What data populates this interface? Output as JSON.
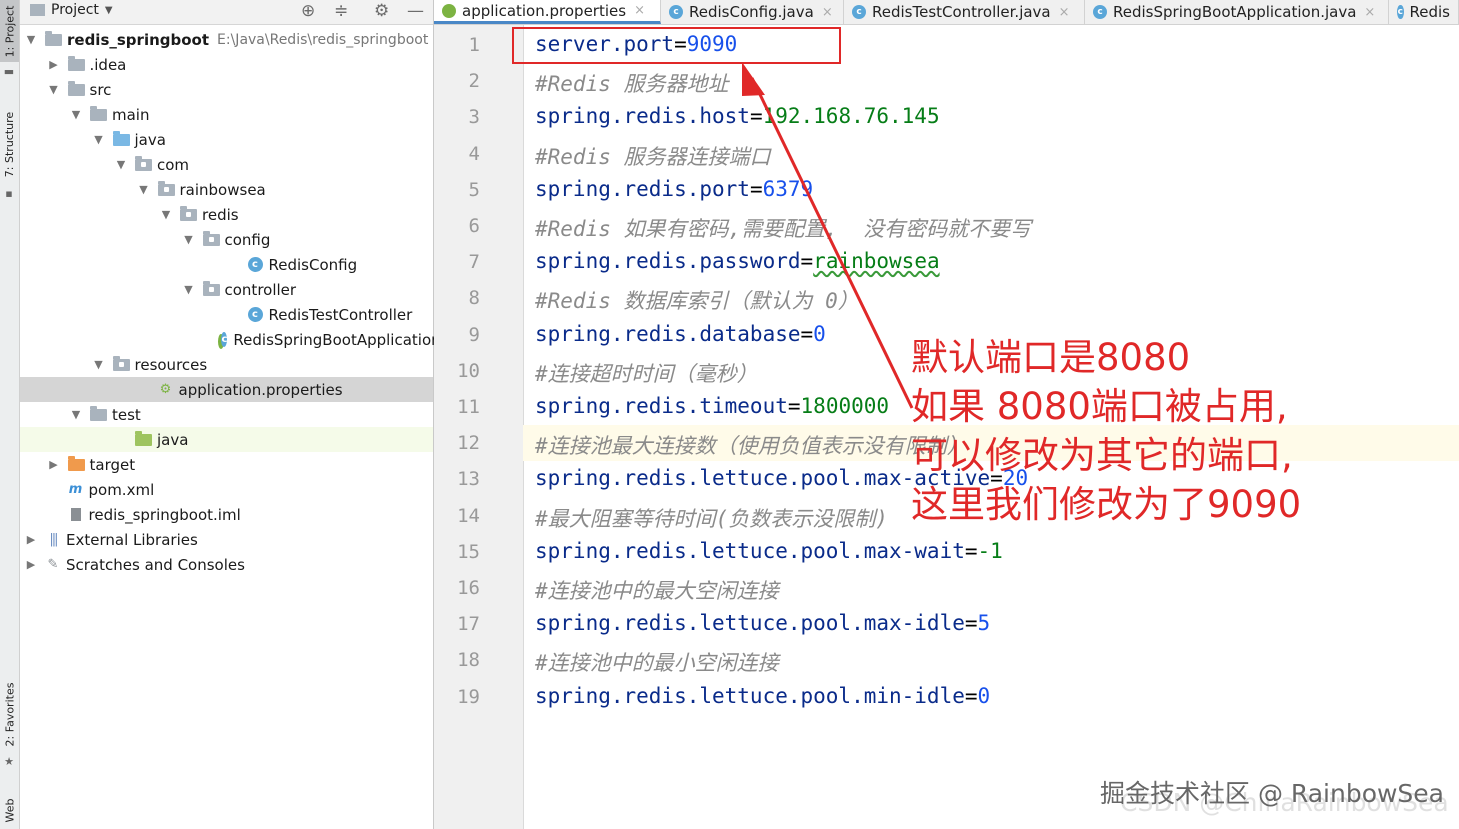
{
  "toolstrip": {
    "project_tab": "1: Project",
    "structure_tab": "7: Structure",
    "favorites_tab": "2: Favorites",
    "web_tab": "Web"
  },
  "project_panel": {
    "title": "Project",
    "tree": [
      {
        "label": "redis_springboot",
        "path": "E:\\Java\\Redis\\redis_springboot",
        "icon": "folder",
        "expanded": true
      },
      {
        "label": ".idea",
        "icon": "folder",
        "expanded": false
      },
      {
        "label": "src",
        "icon": "folder",
        "expanded": true
      },
      {
        "label": "main",
        "icon": "folder",
        "expanded": true
      },
      {
        "label": "java",
        "icon": "source-folder",
        "expanded": true
      },
      {
        "label": "com",
        "icon": "package",
        "expanded": true
      },
      {
        "label": "rainbowsea",
        "icon": "package",
        "expanded": true
      },
      {
        "label": "redis",
        "icon": "package",
        "expanded": true
      },
      {
        "label": "config",
        "icon": "package",
        "expanded": true
      },
      {
        "label": "RedisConfig",
        "icon": "class"
      },
      {
        "label": "controller",
        "icon": "package",
        "expanded": true
      },
      {
        "label": "RedisTestController",
        "icon": "class"
      },
      {
        "label": "RedisSpringBootApplication",
        "icon": "spring-boot-class"
      },
      {
        "label": "resources",
        "icon": "resources-folder",
        "expanded": true
      },
      {
        "label": "application.properties",
        "icon": "properties-file",
        "selected": true
      },
      {
        "label": "test",
        "icon": "folder",
        "expanded": true
      },
      {
        "label": "java",
        "icon": "test-folder"
      },
      {
        "label": "target",
        "icon": "excluded-folder",
        "expanded": false
      },
      {
        "label": "pom.xml",
        "icon": "maven-file"
      },
      {
        "label": "redis_springboot.iml",
        "icon": "module-file"
      },
      {
        "label": "External Libraries",
        "icon": "libraries",
        "expanded": false
      },
      {
        "label": "Scratches and Consoles",
        "icon": "scratches",
        "expanded": false
      }
    ]
  },
  "editor": {
    "tabs": [
      {
        "label": "application.properties",
        "active": true
      },
      {
        "label": "RedisConfig.java"
      },
      {
        "label": "RedisTestController.java"
      },
      {
        "label": "RedisSpringBootApplication.java"
      },
      {
        "label": "Redis"
      }
    ],
    "lines": [
      {
        "n": "1",
        "key": "server.port",
        "eq": "=",
        "val": "9090",
        "type": "num"
      },
      {
        "n": "2",
        "comment": "#Redis 服务器地址"
      },
      {
        "n": "3",
        "key": "spring.redis.host",
        "eq": "=",
        "val": "192.168.76.145",
        "type": "str"
      },
      {
        "n": "4",
        "comment": "#Redis 服务器连接端口"
      },
      {
        "n": "5",
        "key": "spring.redis.port",
        "eq": "=",
        "val": "6379",
        "type": "num"
      },
      {
        "n": "6",
        "comment": "#Redis 如果有密码,需要配置,  没有密码就不要写"
      },
      {
        "n": "7",
        "key": "spring.redis.password",
        "eq": "=",
        "val": "rainbowsea",
        "type": "str"
      },
      {
        "n": "8",
        "comment": "#Redis 数据库索引（默认为 0）"
      },
      {
        "n": "9",
        "key": "spring.redis.database",
        "eq": "=",
        "val": "0",
        "type": "num"
      },
      {
        "n": "10",
        "comment": "#连接超时时间（毫秒）"
      },
      {
        "n": "11",
        "key": "spring.redis.timeout",
        "eq": "=",
        "val": "1800000",
        "type": "str"
      },
      {
        "n": "12",
        "comment": "#连接池最大连接数（使用负值表示没有限制）"
      },
      {
        "n": "13",
        "key": "spring.redis.lettuce.pool.max-active",
        "eq": "=",
        "val": "20",
        "type": "num"
      },
      {
        "n": "14",
        "comment": "#最大阻塞等待时间(负数表示没限制)"
      },
      {
        "n": "15",
        "key": "spring.redis.lettuce.pool.max-wait",
        "eq": "=",
        "val": "-1",
        "type": "str"
      },
      {
        "n": "16",
        "comment": "#连接池中的最大空闲连接"
      },
      {
        "n": "17",
        "key": "spring.redis.lettuce.pool.max-idle",
        "eq": "=",
        "val": "5",
        "type": "num"
      },
      {
        "n": "18",
        "comment": "#连接池中的最小空闲连接"
      },
      {
        "n": "19",
        "key": "spring.redis.lettuce.pool.min-idle",
        "eq": "=",
        "val": "0",
        "type": "num"
      }
    ]
  },
  "annotation": {
    "lines": [
      "默认端口是8080",
      "如果 8080端口被占用,",
      "可以修改为其它的端口,",
      "这里我们修改为了9090"
    ],
    "color": "#e02828"
  },
  "watermark": {
    "primary": "掘金技术社区 @ RainbowSea",
    "secondary": "CSDN @ChinaRainbowSea"
  }
}
